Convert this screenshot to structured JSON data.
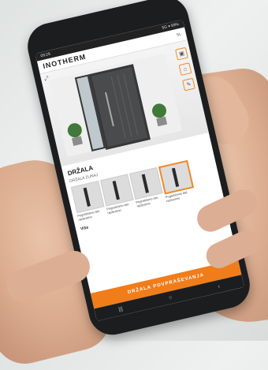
{
  "app": {
    "logo": "INOTHERM",
    "lang": "SL",
    "status_left": "09:29",
    "status_right": "5G ▾ 89%"
  },
  "hero": {
    "expand": "⤢"
  },
  "side_icons": [
    "▣",
    "⌂",
    "✎"
  ],
  "section": {
    "title": "DRŽALA",
    "subtitle": "DRŽALA ZUNAJ"
  },
  "handles": [
    {
      "caption": "Pogrebčeno del. raztezeno"
    },
    {
      "caption": "Pogrebčeno del. raztezeno"
    },
    {
      "caption": "Pogrebčeno del. raztezeno"
    },
    {
      "caption": "Pogrebčeno del. raztezeno"
    }
  ],
  "more": "Više",
  "cta": "DRŽALA POVPRAŠEVANJA",
  "nav": [
    "|||",
    "○",
    "‹"
  ],
  "colors": {
    "accent": "#f07d1a",
    "door": "#4a4b4d"
  }
}
